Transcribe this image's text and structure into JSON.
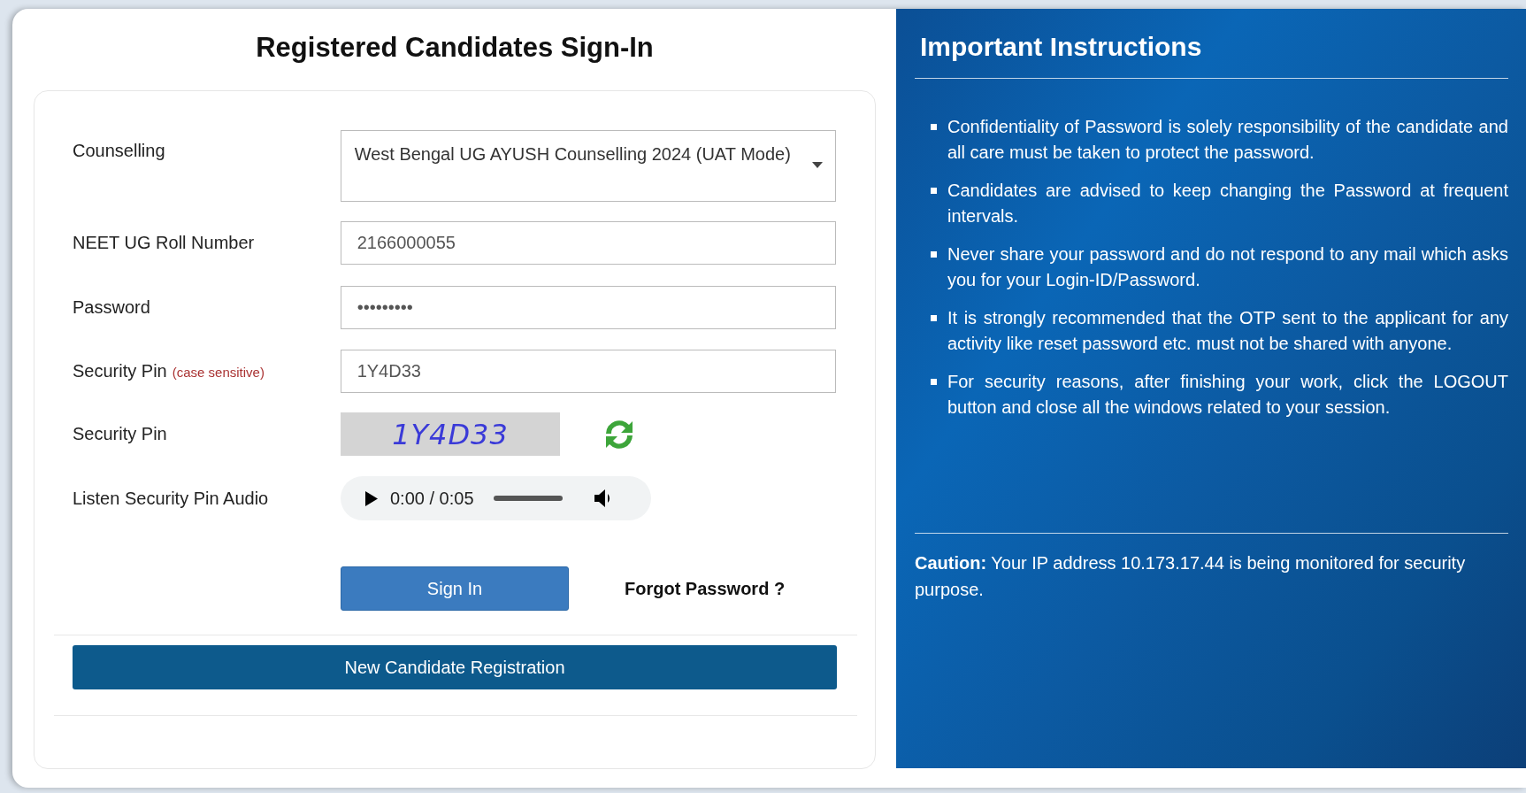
{
  "signin": {
    "title": "Registered Candidates Sign-In",
    "fields": [
      {
        "kind": "select",
        "label": "Counselling",
        "value": "West Bengal UG AYUSH Counselling 2024 (UAT Mode)"
      },
      {
        "kind": "text",
        "label": "NEET UG Roll Number",
        "value": "2166000055"
      },
      {
        "kind": "text",
        "label": "Password",
        "value": "•••••••••"
      },
      {
        "kind": "text",
        "label": "Security Pin",
        "hint": "(case sensitive)",
        "value": "1Y4D33"
      },
      {
        "kind": "captcha",
        "label": "Security Pin",
        "value": "1Y4D33"
      },
      {
        "kind": "audio",
        "label": "Listen Security Pin Audio",
        "value": "0:00 / 0:05"
      }
    ],
    "signin_button": "Sign In",
    "forgot_link": "Forgot Password ?",
    "register_button": "New Candidate Registration"
  },
  "instructions": {
    "title": "Important Instructions",
    "items": [
      "Confidentiality of Password is solely responsibility of the candidate and all care must be taken to protect the password.",
      "Candidates are advised to keep changing the Password at frequent intervals.",
      "Never share your password and do not respond to any mail which asks you for your Login-ID/Password.",
      "It is strongly recommended that the OTP sent to the applicant for any activity like reset password etc. must not be shared with anyone.",
      "For security reasons, after finishing your work, click the LOGOUT button and close all the windows related to your session."
    ],
    "caution": "**Caution:** Your IP address 10.173.17.44 is being monitored for security purpose."
  }
}
